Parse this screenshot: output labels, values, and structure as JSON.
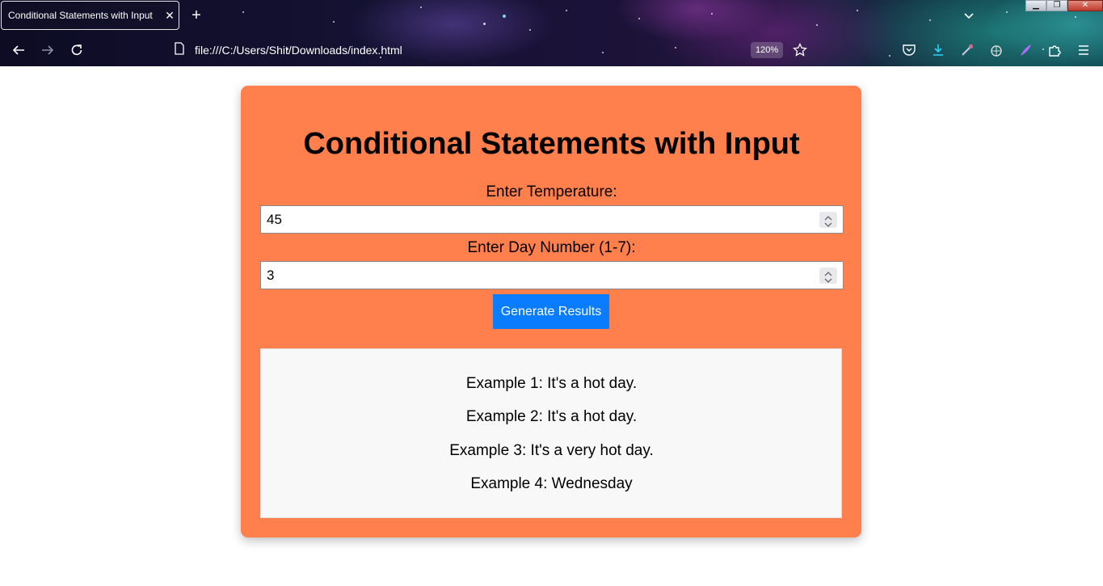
{
  "browser": {
    "tab_title": "Conditional Statements with Input",
    "url": "file:///C:/Users/Shit/Downloads/index.html",
    "zoom": "120%"
  },
  "colors": {
    "card_background": "#ff7f4d",
    "button_background": "#0a7cff",
    "results_background": "#f8f8f8"
  },
  "page": {
    "title": "Conditional Statements with Input",
    "temperature_label": "Enter Temperature:",
    "temperature_value": "45",
    "day_label": "Enter Day Number (1-7):",
    "day_value": "3",
    "generate_button": "Generate Results",
    "results": [
      "Example 1: It's a hot day.",
      "Example 2: It's a hot day.",
      "Example 3: It's a very hot day.",
      "Example 4: Wednesday"
    ]
  }
}
